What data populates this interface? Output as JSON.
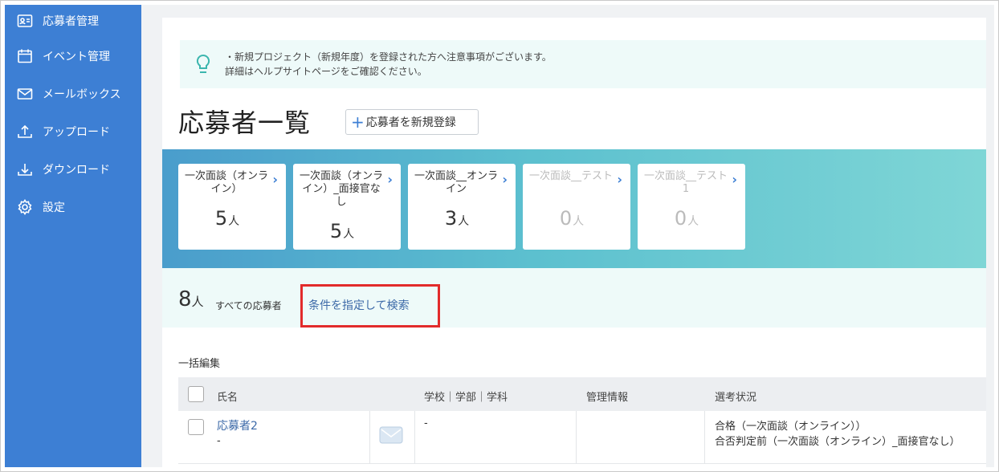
{
  "sidebar": {
    "items": [
      {
        "label": "応募者管理",
        "icon": "id-card-icon"
      },
      {
        "label": "イベント管理",
        "icon": "calendar-icon"
      },
      {
        "label": "メールボックス",
        "icon": "mail-icon"
      },
      {
        "label": "アップロード",
        "icon": "upload-icon"
      },
      {
        "label": "ダウンロード",
        "icon": "download-icon"
      },
      {
        "label": "設定",
        "icon": "gear-icon"
      }
    ]
  },
  "notice": {
    "line1": "・新規プロジェクト（新規年度）を登録された方へ注意事項がございます。",
    "line2": "詳細はヘルプサイトページをご確認ください。"
  },
  "page": {
    "title": "応募者一覧",
    "add_button": "応募者を新規登録"
  },
  "stages": [
    {
      "name": "一次面談（オンライン）",
      "count": "5",
      "unit": "人"
    },
    {
      "name": "一次面談（オンライン）_面接官なし",
      "count": "5",
      "unit": "人"
    },
    {
      "name": "一次面談__オンライン",
      "count": "3",
      "unit": "人"
    },
    {
      "name": "一次面談__テスト",
      "count": "0",
      "unit": "人"
    },
    {
      "name": "一次面談__テスト1",
      "count": "0",
      "unit": "人"
    }
  ],
  "summary": {
    "total": "8",
    "unit": "人",
    "label": "すべての応募者",
    "search_link": "条件を指定して検索"
  },
  "bulk_edit": "一括編集",
  "table": {
    "headers": {
      "name": "氏名",
      "school": "学校｜学部｜学科",
      "admin": "管理情報",
      "status": "選考状況"
    },
    "rows": [
      {
        "name": "応募者2",
        "sub": "-",
        "school": "-",
        "status1": "合格（一次面談（オンライン））",
        "status2": "合否判定前（一次面談（オンライン）_面接官なし）"
      }
    ]
  },
  "colors": {
    "sidebar": "#3d7fd4",
    "accent": "#3d7fd4",
    "highlight": "#e22b2b",
    "notice_icon": "#3cb6ae"
  }
}
